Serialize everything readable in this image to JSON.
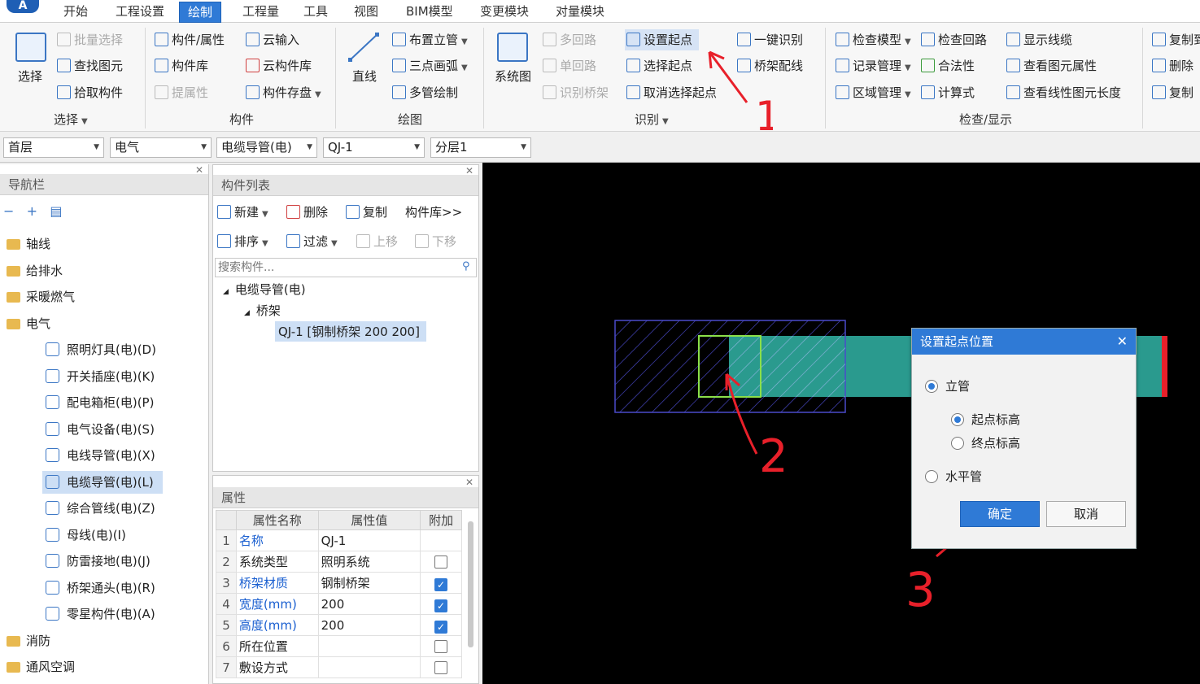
{
  "app": {
    "logo": "A"
  },
  "tabs": [
    "开始",
    "工程设置",
    "绘制",
    "工程量",
    "工具",
    "视图",
    "BIM模型",
    "变更模块",
    "对量模块"
  ],
  "ribbon": {
    "select_group": {
      "big": "选择",
      "items": [
        "批量选择",
        "查找图元",
        "拾取构件"
      ],
      "label": "选择"
    },
    "component_group": {
      "items": [
        "构件/属性",
        "云输入",
        "构件库",
        "云构件库",
        "提属性",
        "构件存盘"
      ],
      "label": "构件"
    },
    "draw_group": {
      "big": "直线",
      "items": [
        "布置立管",
        "三点画弧",
        "多管绘制"
      ],
      "label": "绘图"
    },
    "identify_group": {
      "big": "系统图",
      "items": [
        "多回路",
        "单回路",
        "识别桥架",
        "设置起点",
        "选择起点",
        "取消选择起点",
        "一键识别",
        "桥架配线"
      ],
      "label": "识别"
    },
    "check_group": {
      "items": [
        "检查模型",
        "检查回路",
        "显示线缆",
        "记录管理",
        "合法性",
        "查看图元属性",
        "区域管理",
        "计算式",
        "查看线性图元长度"
      ],
      "label": "检查/显示"
    },
    "edit_group": {
      "items": [
        "复制到",
        "删除",
        "复制"
      ]
    }
  },
  "filters": [
    "首层",
    "电气",
    "电缆导管(电)",
    "QJ-1",
    "分层1"
  ],
  "nav": {
    "title": "导航栏",
    "folders_top": [
      "轴线",
      "给排水",
      "采暖燃气",
      "电气"
    ],
    "electrical": [
      "照明灯具(电)(D)",
      "开关插座(电)(K)",
      "配电箱柜(电)(P)",
      "电气设备(电)(S)",
      "电线导管(电)(X)",
      "电缆导管(电)(L)",
      "综合管线(电)(Z)",
      "母线(电)(I)",
      "防雷接地(电)(J)",
      "桥架通头(电)(R)",
      "零星构件(电)(A)"
    ],
    "folders_bottom": [
      "消防",
      "通风空调"
    ]
  },
  "component_list": {
    "title": "构件列表",
    "toolbar1": [
      "新建",
      "删除",
      "复制",
      "构件库>>"
    ],
    "toolbar2": [
      "排序",
      "过滤",
      "上移",
      "下移"
    ],
    "search_placeholder": "搜索构件...",
    "tree": [
      "电缆导管(电)",
      "桥架",
      "QJ-1 [钢制桥架 200 200]"
    ]
  },
  "properties": {
    "title": "属性",
    "headers": [
      "属性名称",
      "属性值",
      "附加"
    ],
    "rows": [
      {
        "n": "1",
        "name": "名称",
        "value": "QJ-1",
        "blue": true,
        "chk": null
      },
      {
        "n": "2",
        "name": "系统类型",
        "value": "照明系统",
        "blue": false,
        "chk": false
      },
      {
        "n": "3",
        "name": "桥架材质",
        "value": "钢制桥架",
        "blue": true,
        "chk": true
      },
      {
        "n": "4",
        "name": "宽度(mm)",
        "value": "200",
        "blue": true,
        "chk": true
      },
      {
        "n": "5",
        "name": "高度(mm)",
        "value": "200",
        "blue": true,
        "chk": true
      },
      {
        "n": "6",
        "name": "所在位置",
        "value": "",
        "blue": false,
        "chk": false
      },
      {
        "n": "7",
        "name": "敷设方式",
        "value": "",
        "blue": false,
        "chk": false
      }
    ]
  },
  "dialog": {
    "title": "设置起点位置",
    "close": "✕",
    "option_vertical": "立管",
    "sub_start": "起点标高",
    "sub_end": "终点标高",
    "option_horizontal": "水平管",
    "ok": "确定",
    "cancel": "取消"
  },
  "annotations": [
    "1",
    "2",
    "3"
  ],
  "colors": {
    "accent": "#2f7ad6",
    "annotation": "#e8202a",
    "canvas": "#000000",
    "tray_fill": "#2a9a8e",
    "hatch": "#4a4acb",
    "highlight": "#8be04a"
  }
}
